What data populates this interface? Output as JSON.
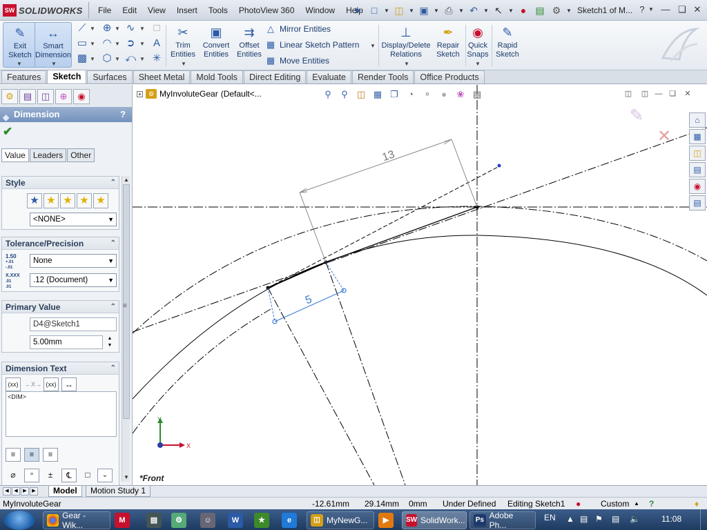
{
  "app": {
    "logo_mark": "SW",
    "logo_text": "SOLIDWORKS",
    "document_title": "Sketch1 of M...",
    "menu": [
      "File",
      "Edit",
      "View",
      "Insert",
      "Tools",
      "PhotoView 360",
      "Window",
      "Help"
    ]
  },
  "ribbon": {
    "exit_sketch": [
      "Exit",
      "Sketch"
    ],
    "smart_dimension": [
      "Smart",
      "Dimension"
    ],
    "trim_entities": [
      "Trim",
      "Entities"
    ],
    "convert_entities": [
      "Convert",
      "Entities"
    ],
    "offset_entities": [
      "Offset",
      "Entities"
    ],
    "mirror_entities": "Mirror Entities",
    "linear_sketch_pattern": "Linear Sketch Pattern",
    "move_entities": "Move Entities",
    "display_delete_relations": [
      "Display/Delete",
      "Relations"
    ],
    "repair_sketch": [
      "Repair",
      "Sketch"
    ],
    "quick_snaps": [
      "Quick",
      "Snaps"
    ],
    "rapid_sketch": [
      "Rapid",
      "Sketch"
    ]
  },
  "command_tabs": [
    {
      "label": "Features",
      "active": false
    },
    {
      "label": "Sketch",
      "active": true
    },
    {
      "label": "Surfaces",
      "active": false
    },
    {
      "label": "Sheet Metal",
      "active": false
    },
    {
      "label": "Mold Tools",
      "active": false
    },
    {
      "label": "Direct Editing",
      "active": false
    },
    {
      "label": "Evaluate",
      "active": false
    },
    {
      "label": "Render Tools",
      "active": false
    },
    {
      "label": "Office Products",
      "active": false
    }
  ],
  "property_manager": {
    "title": "Dimension",
    "help": "?",
    "tabs": [
      {
        "label": "Value",
        "active": true
      },
      {
        "label": "Leaders",
        "active": false
      },
      {
        "label": "Other",
        "active": false
      }
    ],
    "style": {
      "heading": "Style",
      "selected": "<NONE>"
    },
    "tolerance": {
      "heading": "Tolerance/Precision",
      "tolerance_icon": [
        "1.50",
        "+.01",
        "-.01"
      ],
      "tolerance_type": "None",
      "precision_icon": [
        "X.XXX",
        ".01",
        ".01"
      ],
      "precision": ".12 (Document)"
    },
    "primary_value": {
      "heading": "Primary Value",
      "name": "D4@Sketch1",
      "value": "5.00mm"
    },
    "dimension_text": {
      "heading": "Dimension Text",
      "buttons": [
        "(xx)",
        "←X→",
        "(xx)"
      ],
      "text": "<DIM>"
    }
  },
  "viewport": {
    "tree_title": "MyInvoluteGear",
    "tree_config": "(Default<...",
    "view_name": "*Front",
    "triad_labels": {
      "y": "Y",
      "x": "X"
    },
    "dimensions": {
      "long": "13",
      "short": "5"
    }
  },
  "bottom_tabs": [
    {
      "label": "Model",
      "active": true
    },
    {
      "label": "Motion Study 1",
      "active": false
    }
  ],
  "status": {
    "file": "MyInvoluteGear",
    "x": "-12.61mm",
    "y": "29.14mm",
    "z": "0mm",
    "state": "Under Defined",
    "editing": "Editing Sketch1",
    "units": "Custom"
  },
  "taskbar": {
    "chrome": "Gear - Wik...",
    "explorer": "MyNewG...",
    "solidworks": "SolidWork...",
    "photoshop": "Adobe Ph...",
    "language": "EN",
    "clock": "11:08",
    "pins": {
      "word": "W",
      "photoshop": "Ps",
      "solidworks": "SW"
    }
  },
  "colors": {
    "accent": "#c8102e",
    "dimension_blue": "#3a7bd5",
    "header_blue": "#7392bd"
  }
}
